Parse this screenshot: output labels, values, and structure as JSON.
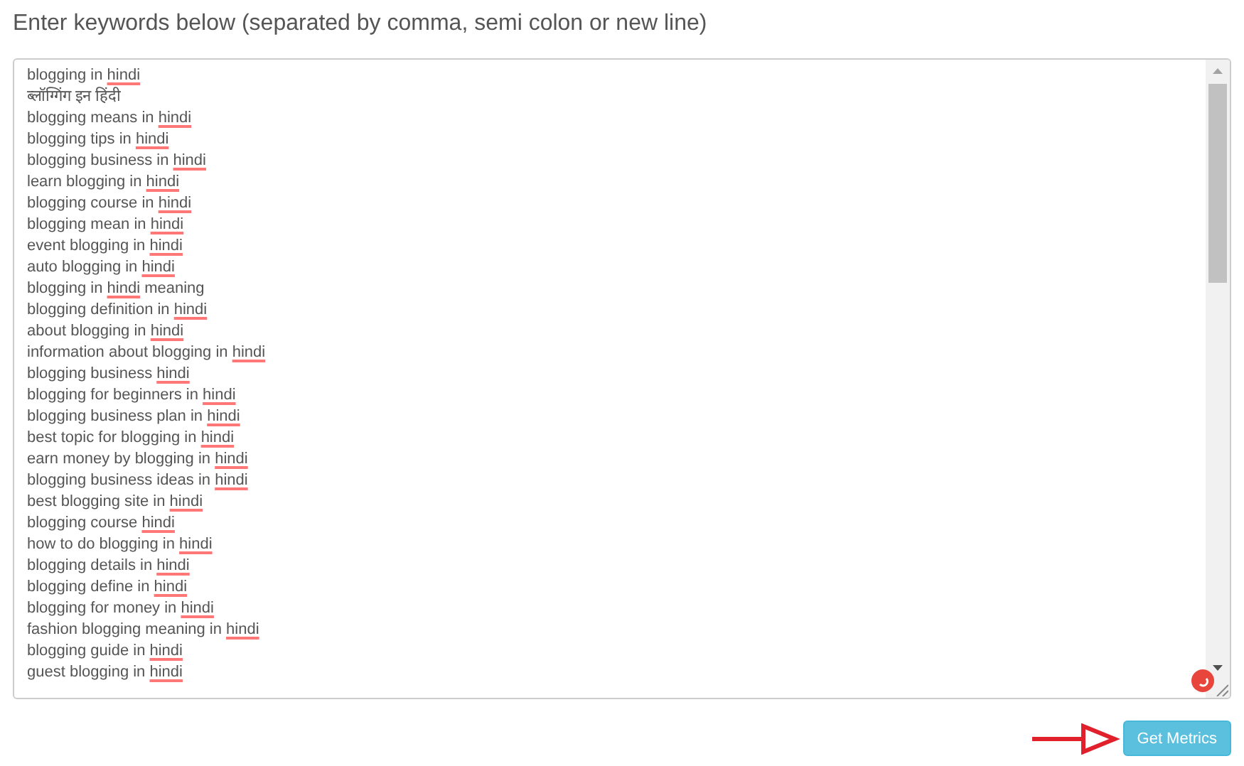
{
  "heading": "Enter keywords below (separated by comma, semi colon or new line)",
  "keywords": [
    [
      {
        "t": "blogging in "
      },
      {
        "t": "hindi",
        "flagged": true
      }
    ],
    [
      {
        "t": "ब्लॉग्गिंग इन हिंदी"
      }
    ],
    [
      {
        "t": "blogging means in "
      },
      {
        "t": "hindi",
        "flagged": true
      }
    ],
    [
      {
        "t": "blogging tips in "
      },
      {
        "t": "hindi",
        "flagged": true
      }
    ],
    [
      {
        "t": "blogging business in "
      },
      {
        "t": "hindi",
        "flagged": true
      }
    ],
    [
      {
        "t": "learn blogging in "
      },
      {
        "t": "hindi",
        "flagged": true
      }
    ],
    [
      {
        "t": "blogging course in "
      },
      {
        "t": "hindi",
        "flagged": true
      }
    ],
    [
      {
        "t": "blogging mean in "
      },
      {
        "t": "hindi",
        "flagged": true
      }
    ],
    [
      {
        "t": "event blogging in "
      },
      {
        "t": "hindi",
        "flagged": true
      }
    ],
    [
      {
        "t": "auto blogging in "
      },
      {
        "t": "hindi",
        "flagged": true
      }
    ],
    [
      {
        "t": "blogging in "
      },
      {
        "t": "hindi",
        "flagged": true
      },
      {
        "t": " meaning"
      }
    ],
    [
      {
        "t": "blogging definition in "
      },
      {
        "t": "hindi",
        "flagged": true
      }
    ],
    [
      {
        "t": "about blogging in "
      },
      {
        "t": "hindi",
        "flagged": true
      }
    ],
    [
      {
        "t": "information about blogging in "
      },
      {
        "t": "hindi",
        "flagged": true
      }
    ],
    [
      {
        "t": "blogging business "
      },
      {
        "t": "hindi",
        "flagged": true
      }
    ],
    [
      {
        "t": "blogging for beginners in "
      },
      {
        "t": "hindi",
        "flagged": true
      }
    ],
    [
      {
        "t": "blogging business plan in "
      },
      {
        "t": "hindi",
        "flagged": true
      }
    ],
    [
      {
        "t": "best topic for blogging in "
      },
      {
        "t": "hindi",
        "flagged": true
      }
    ],
    [
      {
        "t": "earn money by blogging in "
      },
      {
        "t": "hindi",
        "flagged": true
      }
    ],
    [
      {
        "t": "blogging business ideas in "
      },
      {
        "t": "hindi",
        "flagged": true
      }
    ],
    [
      {
        "t": "best blogging site in "
      },
      {
        "t": "hindi",
        "flagged": true
      }
    ],
    [
      {
        "t": "blogging course "
      },
      {
        "t": "hindi",
        "flagged": true
      }
    ],
    [
      {
        "t": "how to do blogging in "
      },
      {
        "t": "hindi",
        "flagged": true
      }
    ],
    [
      {
        "t": "blogging details in "
      },
      {
        "t": "hindi",
        "flagged": true
      }
    ],
    [
      {
        "t": "blogging define in "
      },
      {
        "t": "hindi",
        "flagged": true
      }
    ],
    [
      {
        "t": "blogging for money in "
      },
      {
        "t": "hindi",
        "flagged": true
      }
    ],
    [
      {
        "t": "fashion blogging meaning in "
      },
      {
        "t": "hindi",
        "flagged": true
      }
    ],
    [
      {
        "t": "blogging guide in "
      },
      {
        "t": "hindi",
        "flagged": true
      }
    ],
    [
      {
        "t": "guest blogging in "
      },
      {
        "t": "hindi",
        "flagged": true
      }
    ]
  ],
  "button": "Get Metrics"
}
